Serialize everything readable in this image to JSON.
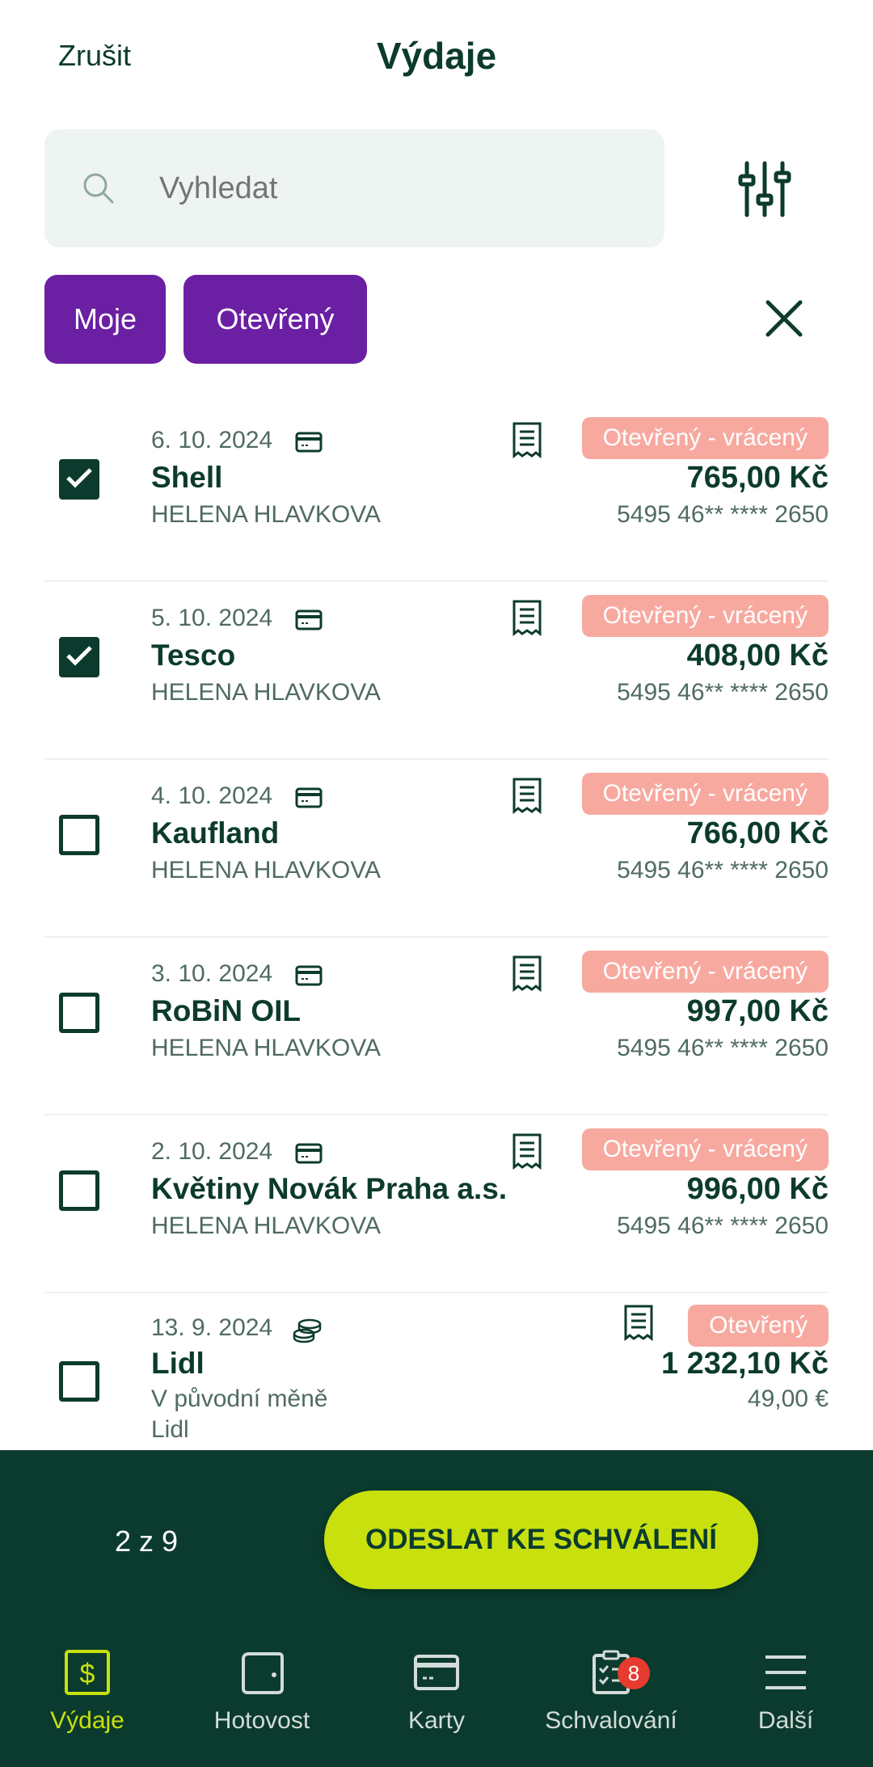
{
  "header": {
    "cancel_label": "Zrušit",
    "title": "Výdaje"
  },
  "search": {
    "placeholder": "Vyhledat"
  },
  "filters": {
    "chips": [
      "Moje",
      "Otevřený"
    ]
  },
  "expenses": [
    {
      "date": "6. 10. 2024",
      "payment_icon": "card-icon",
      "merchant": "Shell",
      "subtitle": "HELENA HLAVKOVA",
      "subtitle2": "",
      "status": "Otevřený - vrácený",
      "amount": "765,00 Kč",
      "secondary": "5495 46** **** 2650",
      "checked": true
    },
    {
      "date": "5. 10. 2024",
      "payment_icon": "card-icon",
      "merchant": "Tesco",
      "subtitle": "HELENA HLAVKOVA",
      "subtitle2": "",
      "status": "Otevřený - vrácený",
      "amount": "408,00 Kč",
      "secondary": "5495 46** **** 2650",
      "checked": true
    },
    {
      "date": "4. 10. 2024",
      "payment_icon": "card-icon",
      "merchant": "Kaufland",
      "subtitle": "HELENA HLAVKOVA",
      "subtitle2": "",
      "status": "Otevřený - vrácený",
      "amount": "766,00 Kč",
      "secondary": "5495 46** **** 2650",
      "checked": false
    },
    {
      "date": "3. 10. 2024",
      "payment_icon": "card-icon",
      "merchant": "RoBiN OIL",
      "subtitle": "HELENA HLAVKOVA",
      "subtitle2": "",
      "status": "Otevřený - vrácený",
      "amount": "997,00 Kč",
      "secondary": "5495 46** **** 2650",
      "checked": false
    },
    {
      "date": "2. 10. 2024",
      "payment_icon": "card-icon",
      "merchant": "Květiny Novák Praha a.s.",
      "subtitle": "HELENA HLAVKOVA",
      "subtitle2": "",
      "status": "Otevřený - vrácený",
      "amount": "996,00 Kč",
      "secondary": "5495 46** **** 2650",
      "checked": false
    },
    {
      "date": "13. 9. 2024",
      "payment_icon": "coins-icon",
      "merchant": "Lidl",
      "subtitle": "V původní měně",
      "subtitle2": "Lidl",
      "status": "Otevřený",
      "amount": "1 232,10 Kč",
      "secondary": "49,00 €",
      "checked": false
    }
  ],
  "action_bar": {
    "count": "2 z 9",
    "submit_label": "ODESLAT KE SCHVÁLENÍ"
  },
  "nav": {
    "items": [
      {
        "label": "Výdaje",
        "icon": "dollar-icon",
        "active": true
      },
      {
        "label": "Hotovost",
        "icon": "wallet-icon",
        "active": false
      },
      {
        "label": "Karty",
        "icon": "card-icon",
        "active": false
      },
      {
        "label": "Schvalování",
        "icon": "checklist-icon",
        "active": false,
        "badge": "8"
      },
      {
        "label": "Další",
        "icon": "menu-icon",
        "active": false
      }
    ]
  },
  "colors": {
    "primary": "#0c3b2e",
    "accent": "#c8e10e",
    "chip": "#6b1fa3",
    "badge": "#f7a9a0",
    "notification": "#e63b2e"
  }
}
